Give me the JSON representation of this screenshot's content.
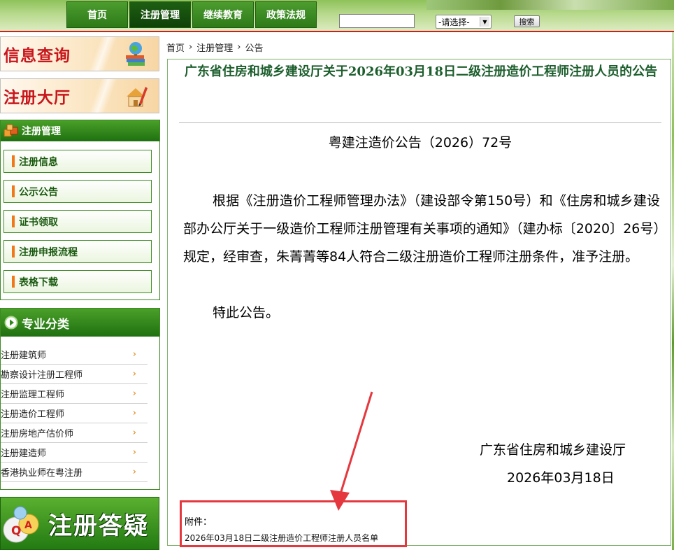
{
  "nav": {
    "items": [
      "首页",
      "注册管理",
      "继续教育",
      "政策法规"
    ],
    "active_index": 1
  },
  "search": {
    "value": "",
    "select_value": "-请选择-",
    "button": "搜索"
  },
  "left": {
    "info_query": "信息查询",
    "reg_hall": "注册大厅",
    "mgmt": {
      "title": "注册管理",
      "items": [
        "注册信息",
        "公示公告",
        "证书领取",
        "注册申报流程",
        "表格下载"
      ]
    },
    "categories": {
      "title": "专业分类",
      "items": [
        "注册建筑师",
        "勘察设计注册工程师",
        "注册监理工程师",
        "注册造价工程师",
        "注册房地产估价师",
        "注册建造师",
        "香港执业师在粤注册"
      ],
      "chevron": "›"
    },
    "qa": "注册答疑",
    "qa_badge_letters": [
      "Q",
      "A"
    ]
  },
  "breadcrumb": [
    "首页",
    "注册管理",
    "公告"
  ],
  "breadcrumb_sep": "›",
  "article": {
    "title": "广东省住房和城乡建设厅关于2026年03月18日二级注册造价工程师注册人员的公告",
    "doc_no": "粤建注造价公告（2026）72号",
    "body": "根据《注册造价工程师管理办法》（建设部令第150号）和《住房和城乡建设部办公厅关于一级造价工程师注册管理有关事项的通知》（建办标〔2020〕26号）规定，经审查，朱菁菁等84人符合二级注册造价工程师注册条件，准予注册。",
    "closing": "特此公告。",
    "signature_org": "广东省住房和城乡建设厅",
    "signature_date": "2026年03月18日",
    "attachment_label": "附件：",
    "attachment_link": "2026年03月18日二级注册造价工程师注册人员名单"
  },
  "colors": {
    "nav_green": "#2d7a18",
    "title_green": "#1d5e2d",
    "banner_red": "#c8161d",
    "highlight_red": "#e5383e",
    "accent_orange": "#f07818"
  }
}
